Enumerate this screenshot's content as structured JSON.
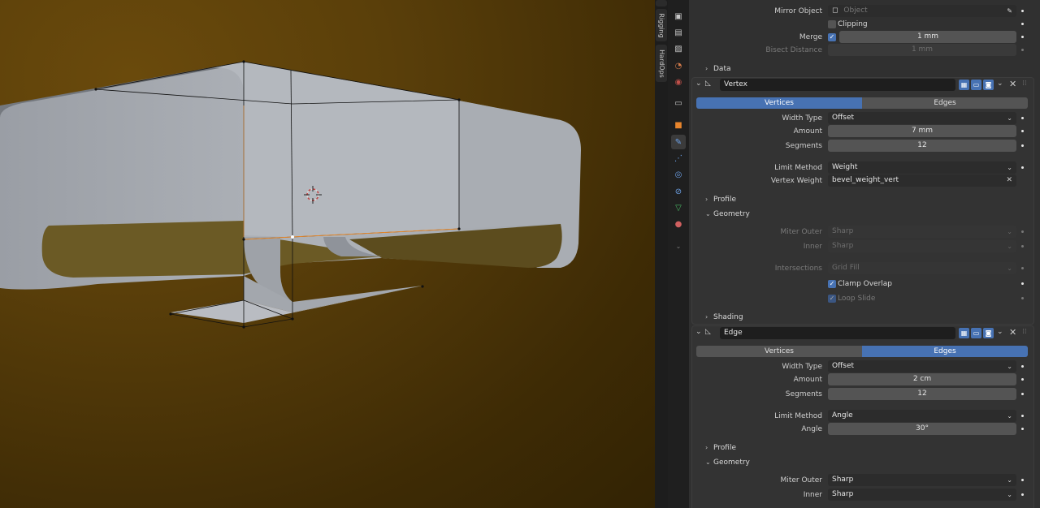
{
  "side_tabs": [
    "Rigging",
    "HardOps"
  ],
  "mirror": {
    "mirror_object_label": "Mirror Object",
    "mirror_object_placeholder": "Object",
    "clipping_label": "Clipping",
    "merge_label": "Merge",
    "merge_value": "1 mm",
    "bisect_label": "Bisect Distance",
    "bisect_value": "1 mm",
    "data_label": "Data"
  },
  "bevel_vertex": {
    "name": "Vertex",
    "tab_vertices": "Vertices",
    "tab_edges": "Edges",
    "affect_selected": "Vertices",
    "width_type_label": "Width Type",
    "width_type_value": "Offset",
    "amount_label": "Amount",
    "amount_value": "7 mm",
    "segments_label": "Segments",
    "segments_value": "12",
    "limit_method_label": "Limit Method",
    "limit_method_value": "Weight",
    "vertex_weight_label": "Vertex Weight",
    "vertex_weight_value": "bevel_weight_vert",
    "profile_label": "Profile",
    "geometry_label": "Geometry",
    "miter_outer_label": "Miter Outer",
    "miter_outer_value": "Sharp",
    "inner_label": "Inner",
    "inner_value": "Sharp",
    "intersections_label": "Intersections",
    "intersections_value": "Grid Fill",
    "clamp_overlap_label": "Clamp Overlap",
    "loop_slide_label": "Loop Slide",
    "shading_label": "Shading"
  },
  "bevel_edge": {
    "name": "Edge",
    "tab_vertices": "Vertices",
    "tab_edges": "Edges",
    "affect_selected": "Edges",
    "width_type_label": "Width Type",
    "width_type_value": "Offset",
    "amount_label": "Amount",
    "amount_value": "2 cm",
    "segments_label": "Segments",
    "segments_value": "12",
    "limit_method_label": "Limit Method",
    "limit_method_value": "Angle",
    "angle_label": "Angle",
    "angle_value": "30°",
    "profile_label": "Profile",
    "geometry_label": "Geometry",
    "miter_outer_label": "Miter Outer",
    "miter_outer_value": "Sharp",
    "inner_label": "Inner",
    "inner_value": "Sharp"
  },
  "property_tabs": [
    "tool-icon",
    "render-icon",
    "output-icon",
    "view-layer-icon",
    "scene-icon",
    "world-icon",
    "collection-icon",
    "object-icon",
    "modifier-icon",
    "particles-icon",
    "physics-icon",
    "constraints-icon",
    "data-icon",
    "material-icon"
  ],
  "colors": {
    "accent": "#4772b3",
    "panel_bg": "#303030",
    "field_bg": "#545454",
    "viewport_bg": "#5a3f0a"
  }
}
